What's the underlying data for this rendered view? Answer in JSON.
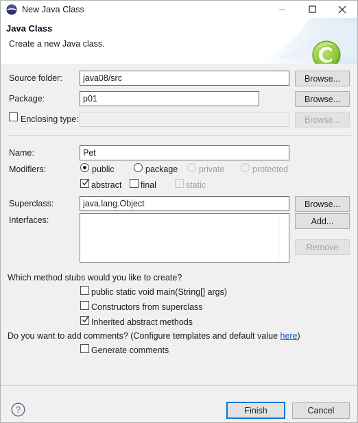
{
  "window": {
    "title": "New Java Class",
    "icon": "java-class-icon",
    "controls": [
      {
        "name": "minimize-button",
        "label": "—",
        "enabled": false
      },
      {
        "name": "maximize-button",
        "label": "□",
        "enabled": true
      },
      {
        "name": "close-button",
        "label": "✕",
        "enabled": true
      }
    ]
  },
  "banner": {
    "heading": "Java Class",
    "subheading": "Create a new Java class.",
    "logo": "green-c-logo"
  },
  "form": {
    "source_folder": {
      "label": "Source folder:",
      "value": "java08/src",
      "button": "Browse..."
    },
    "package": {
      "label": "Package:",
      "value": "p01",
      "button": "Browse..."
    },
    "enclosing_type": {
      "label": "Enclosing type:",
      "value": "",
      "placeholder": "",
      "checked": false,
      "button": "Browse...",
      "enabled": false
    },
    "name": {
      "label": "Name:",
      "value": "Pet"
    },
    "modifiers": {
      "label": "Modifiers:",
      "access": [
        {
          "label": "public",
          "selected": true,
          "enabled": true
        },
        {
          "label": "package",
          "selected": false,
          "enabled": true
        },
        {
          "label": "private",
          "selected": false,
          "enabled": false
        },
        {
          "label": "protected",
          "selected": false,
          "enabled": false
        }
      ],
      "flags": [
        {
          "label": "abstract",
          "checked": true,
          "enabled": true
        },
        {
          "label": "final",
          "checked": false,
          "enabled": true
        },
        {
          "label": "static",
          "checked": false,
          "enabled": false
        }
      ]
    },
    "superclass": {
      "label": "Superclass:",
      "value": "java.lang.Object",
      "button": "Browse..."
    },
    "interfaces": {
      "label": "Interfaces:",
      "items": [],
      "add_button": "Add...",
      "remove_button": "Remove",
      "remove_enabled": false
    }
  },
  "stubs": {
    "question": "Which method stubs would you like to create?",
    "options": [
      {
        "label": "public static void main(String[] args)",
        "checked": false
      },
      {
        "label": "Constructors from superclass",
        "checked": false
      },
      {
        "label": "Inherited abstract methods",
        "checked": true
      }
    ]
  },
  "comments": {
    "question_prefix": "Do you want to add comments? (Configure templates and default value ",
    "link": "here",
    "question_suffix": ")",
    "option": {
      "label": "Generate comments",
      "checked": false
    }
  },
  "footer": {
    "help": "?",
    "finish": "Finish",
    "cancel": "Cancel"
  },
  "colors": {
    "accent": "#0078d7",
    "link": "#1559b5",
    "background": "#f0f0f0",
    "field": "#ffffff",
    "logo_green": "#8cc63f"
  }
}
